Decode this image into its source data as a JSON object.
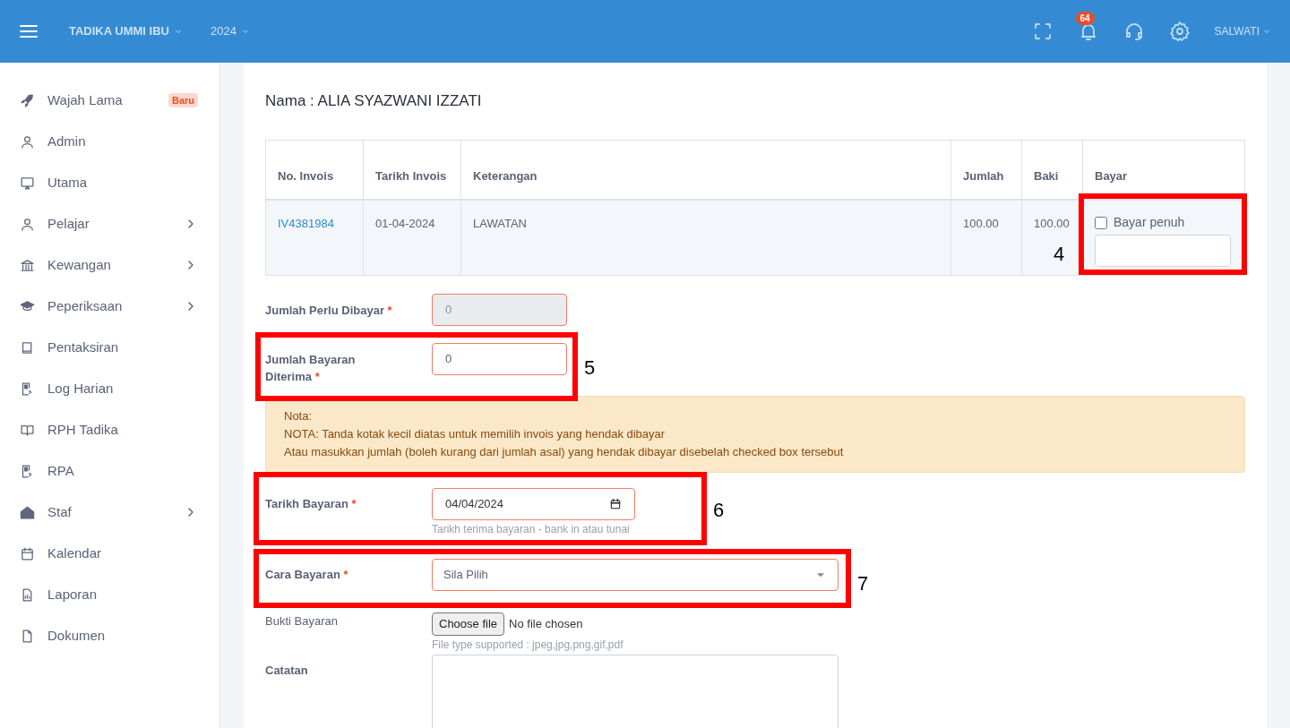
{
  "header": {
    "school": "TADIKA UMMI IBU",
    "year": "2024",
    "notifications": "64",
    "user": "SALWATI"
  },
  "sidebar": {
    "items": [
      {
        "label": "Wajah Lama",
        "badge": "Baru",
        "expandable": false
      },
      {
        "label": "Admin",
        "expandable": false
      },
      {
        "label": "Utama",
        "expandable": false
      },
      {
        "label": "Pelajar",
        "expandable": true
      },
      {
        "label": "Kewangan",
        "expandable": true
      },
      {
        "label": "Peperiksaan",
        "expandable": true
      },
      {
        "label": "Pentaksiran",
        "expandable": false
      },
      {
        "label": "Log Harian",
        "expandable": false
      },
      {
        "label": "RPH Tadika",
        "expandable": false
      },
      {
        "label": "RPA",
        "expandable": false
      },
      {
        "label": "Staf",
        "expandable": true
      },
      {
        "label": "Kalendar",
        "expandable": false
      },
      {
        "label": "Laporan",
        "expandable": false
      },
      {
        "label": "Dokumen",
        "expandable": false
      }
    ]
  },
  "title": "Nama : ALIA SYAZWANI IZZATI",
  "table": {
    "columns": [
      "No. Invois",
      "Tarikh Invois",
      "Keterangan",
      "Jumlah",
      "Baki",
      "Bayar"
    ],
    "rows": [
      {
        "invoice": "IV4381984",
        "date": "01-04-2024",
        "description": "LAWATAN",
        "amount": "100.00",
        "balance": "100.00",
        "pay_full": {
          "label": "Bayar penuh",
          "checked": false
        }
      }
    ]
  },
  "form": {
    "fields": [
      {
        "kind": "input",
        "label": "Jumlah Perlu Dibayar",
        "required_mark": "*",
        "value": "0",
        "disabled": true
      },
      {
        "kind": "input",
        "label": "Jumlah Bayaran Diterima",
        "required_mark": "*",
        "value": "0",
        "disabled": false
      },
      {
        "kind": "note",
        "lines": [
          "Nota:",
          "NOTA: Tanda kotak kecil diatas untuk memilih invois yang hendak dibayar",
          "Atau masukkan jumlah (boleh kurang dari jumlah asal) yang hendak dibayar disebelah checked box tersebut"
        ]
      },
      {
        "kind": "date",
        "label": "Tarikh Bayaran",
        "required_mark": "*",
        "value": "04/04/2024",
        "help": "Tarikh terima bayaran - bank in atau tunai"
      },
      {
        "kind": "select",
        "label": "Cara Bayaran",
        "required_mark": "*",
        "value": "Sila Pilih"
      },
      {
        "kind": "file",
        "label": "Bukti Bayaran",
        "button": "Choose file",
        "status": "No file chosen",
        "help": "File type supported : jpeg,jpg,png,gif,pdf"
      },
      {
        "kind": "textarea",
        "label": "Catatan"
      }
    ]
  },
  "annotations": [
    {
      "label": "4"
    },
    {
      "label": "5"
    },
    {
      "label": "6"
    },
    {
      "label": "7"
    }
  ]
}
